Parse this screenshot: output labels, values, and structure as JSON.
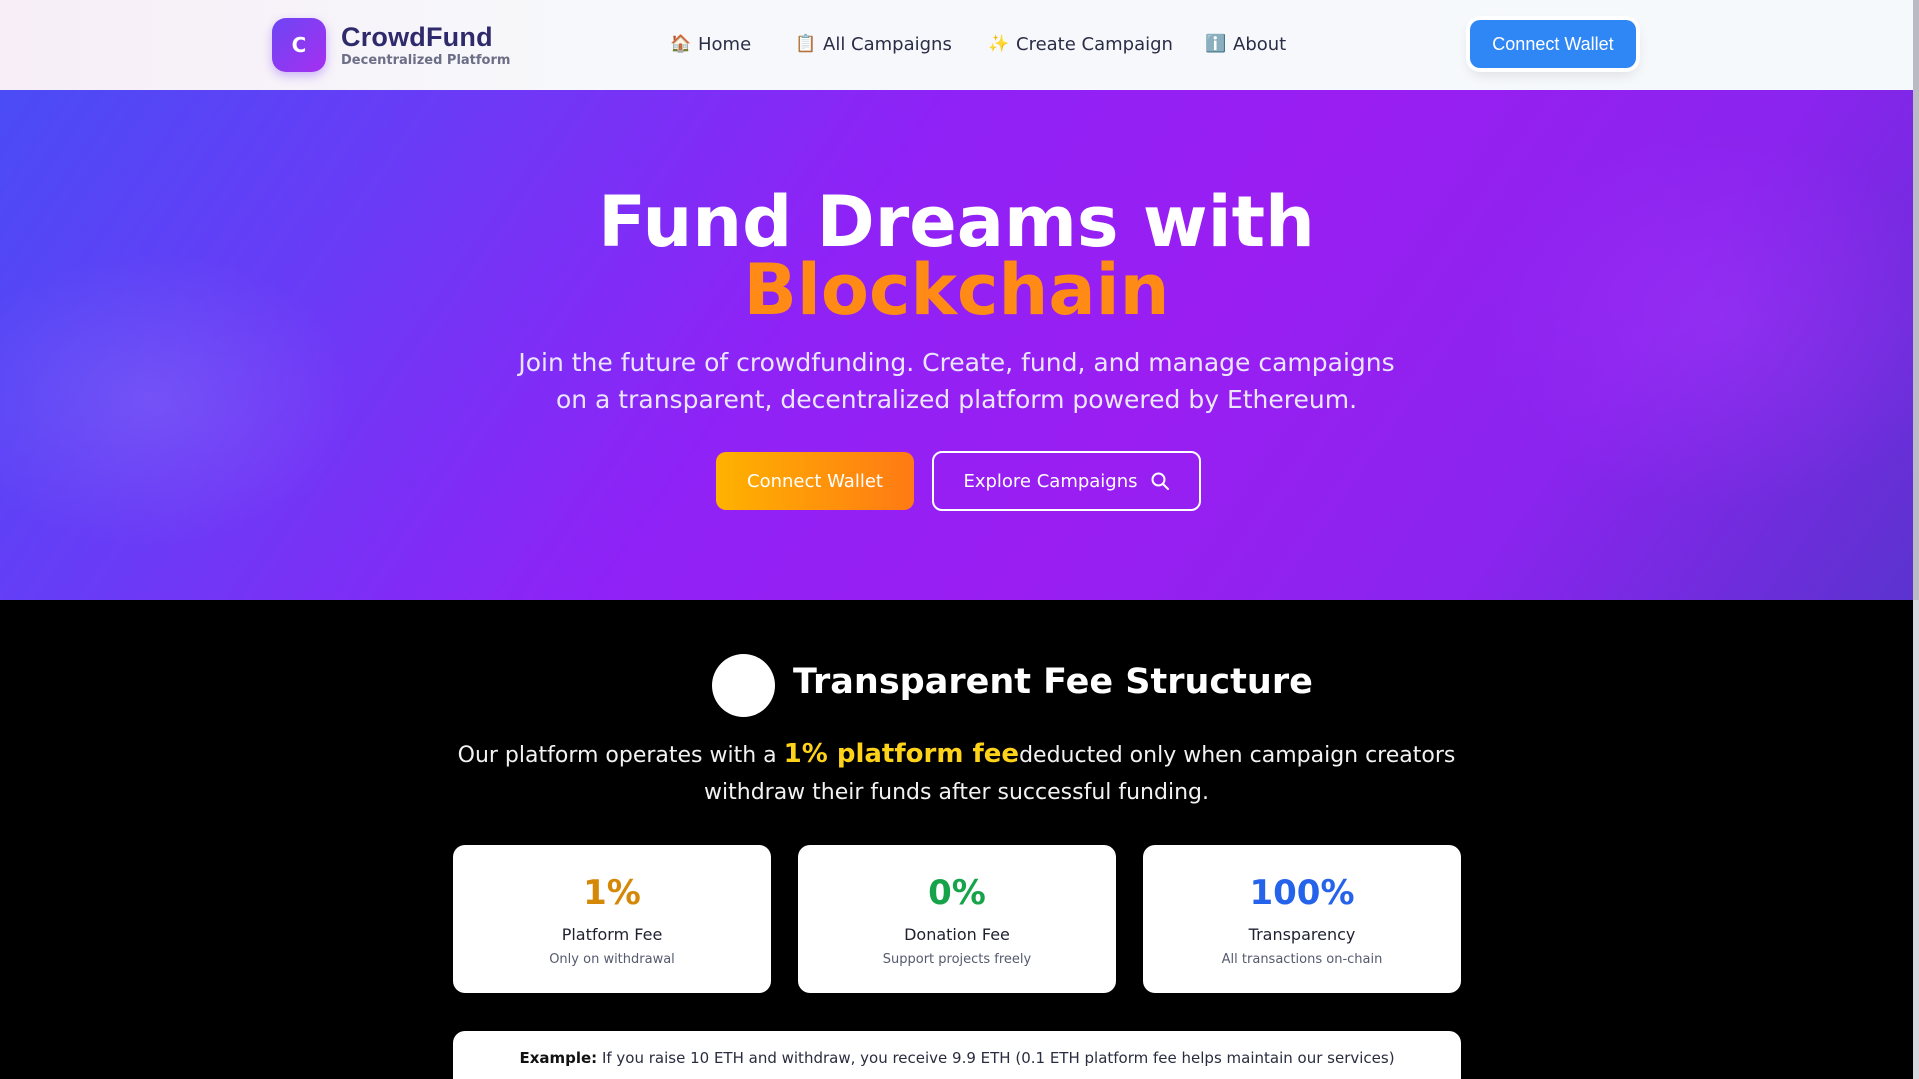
{
  "brand": {
    "logo_letter": "C",
    "name": "CrowdFund",
    "tagline": "Decentralized Platform"
  },
  "nav": {
    "items": [
      {
        "icon": "house-icon",
        "glyph": "🏠",
        "label": "Home"
      },
      {
        "icon": "clipboard-icon",
        "glyph": "📋",
        "label": "All Campaigns"
      },
      {
        "icon": "sparkles-icon",
        "glyph": "✨",
        "label": "Create Campaign"
      },
      {
        "icon": "info-icon",
        "glyph": "ℹ️",
        "label": "About"
      }
    ],
    "wallet_label": "Connect Wallet"
  },
  "hero": {
    "title_line1": "Fund Dreams with",
    "title_line2": "Blockchain",
    "description": "Join the future of crowdfunding. Create, fund, and manage campaigns on a transparent, decentralized platform powered by Ethereum.",
    "primary_button": "Connect Wallet",
    "secondary_button": "Explore Campaigns"
  },
  "fees": {
    "title": "Transparent Fee Structure",
    "desc_before": "Our platform operates with a ",
    "desc_highlight": "1% platform fee",
    "desc_after": "deducted only when campaign creators withdraw their funds after successful funding.",
    "cards": [
      {
        "value": "1%",
        "label": "Platform Fee",
        "sub": "Only on withdrawal",
        "color": "#d48806"
      },
      {
        "value": "0%",
        "label": "Donation Fee",
        "sub": "Support projects freely",
        "color": "#16a34a"
      },
      {
        "value": "100%",
        "label": "Transparency",
        "sub": "All transactions on-chain",
        "color": "#2563eb"
      }
    ],
    "example_label": "Example:",
    "example_text": " If you raise 10 ETH and withdraw, you receive 9.9 ETH (0.1 ETH platform fee helps maintain our services)"
  },
  "colors": {
    "accent_blue": "#2f86f5",
    "accent_orange": "#ff8a16",
    "highlight_yellow": "#ffd21a"
  }
}
